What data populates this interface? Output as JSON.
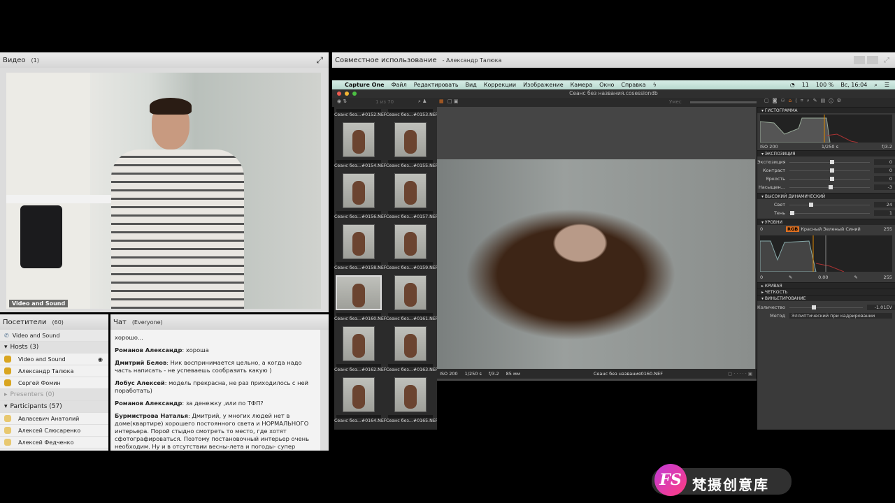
{
  "video_pod": {
    "title": "Видео",
    "count": "(1)",
    "feed_label": "Video and Sound"
  },
  "attendees": {
    "title": "Посетители",
    "count": "(60)",
    "audio_item": "Video and Sound",
    "groups": [
      {
        "label": "Hosts (3)",
        "expanded": true,
        "members": [
          "Video and Sound",
          "Александр Талюка",
          "Сергей Фомин"
        ]
      },
      {
        "label": "Presenters (0)",
        "expanded": false,
        "members": []
      },
      {
        "label": "Participants (57)",
        "expanded": true,
        "members": [
          "Авласевич Анатолий",
          "Алексей Слюсаренко",
          "Алексей Федченко"
        ]
      }
    ]
  },
  "chat": {
    "title": "Чат",
    "scope": "(Everyone)",
    "messages": [
      {
        "author": "",
        "text": "хорошо..."
      },
      {
        "author": "Романов Александр",
        "text": ": хороша"
      },
      {
        "author": "Дмитрий Белов",
        "text": ": Ник воспринимается цельно, а когда надо часть написать - не успеваешь сообразить какую )"
      },
      {
        "author": "Лобус Алексей",
        "text": ": модель прекрасна, не раз приходилось с ней поработать)"
      },
      {
        "author": "Романов Александр",
        "text": ": за денежку ,или по ТФП?"
      },
      {
        "author": "Бурмистрова Наталья",
        "text": ": Дмитрий, у многих людей нет в доме(квартире) хорошего постоянного света и НОРМАЛЬНОГО интерьера. Порой стыдно смотреть то место, где хотят сфотографироваться. Поэтому постановочный интерьер очень необходим.  Ну и в отсутствии весны-лета и погоды- супер вариант"
      }
    ]
  },
  "share_pod": {
    "title": "Совместное использование",
    "presenter": "- Александр Талюка"
  },
  "menubar": {
    "app": "Capture One",
    "items": [
      "Файл",
      "Редактировать",
      "Вид",
      "Коррекции",
      "Изображение",
      "Камера",
      "Окно",
      "Справка"
    ],
    "battery": "100 %",
    "clock": "Вс, 16:04",
    "badge": "11"
  },
  "window": {
    "title": "Сеанс без названия.cosessiondb",
    "count": "1 из 70",
    "zoom_label": "Умес"
  },
  "filmstrip": {
    "thumbs": [
      "Сеанс без...#0152.NEF",
      "Сеанс без...#0153.NEF",
      "Сеанс без...#0154.NEF",
      "Сеанс без...#0155.NEF",
      "Сеанс без...#0156.NEF",
      "Сеанс без...#0157.NEF",
      "Сеанс без...#0158.NEF",
      "Сеанс без...#0159.NEF",
      "Сеанс без...#0160.NEF",
      "Сеанс без...#0161.NEF",
      "Сеанс без...#0162.NEF",
      "Сеанс без...#0163.NEF",
      "Сеанс без...#0164.NEF",
      "Сеанс без...#0165.NEF"
    ],
    "selected": 8
  },
  "viewer": {
    "iso": "ISO 200",
    "shutter": "1/250 s",
    "aperture": "f/3.2",
    "focal": "85 мм",
    "filename": "Сеанс без названия0160.NEF"
  },
  "tools": {
    "histogram": {
      "title": "ГИСТОГРАММА",
      "iso": "ISO 200",
      "shutter": "1/250 s",
      "aperture": "f/3.2"
    },
    "exposure": {
      "title": "ЭКСПОЗИЦИЯ",
      "rows": [
        {
          "label": "Экспозиция",
          "value": "0",
          "pos": 0.5
        },
        {
          "label": "Контраст",
          "value": "0",
          "pos": 0.5
        },
        {
          "label": "Яркость",
          "value": "0",
          "pos": 0.5
        },
        {
          "label": "Насыщен...",
          "value": "-3",
          "pos": 0.49
        }
      ]
    },
    "hdr": {
      "title": "ВЫСОКИЙ ДИНАМИЧЕСКИЙ",
      "rows": [
        {
          "label": "Свет",
          "value": "24",
          "pos": 0.24
        },
        {
          "label": "Тень",
          "value": "1",
          "pos": 0.01
        }
      ]
    },
    "levels": {
      "title": "УРОВНИ",
      "low": "0",
      "high": "255",
      "channels": [
        "RGB",
        "Красный",
        "Зеленый",
        "Синий"
      ],
      "out_low": "0",
      "mid": "0.00",
      "out_high": "255"
    },
    "curve": "КРИВАЯ",
    "clarity": "ЧЕТКОСТЬ",
    "vignette": {
      "title": "ВИНЬЕТИРОВАНИЕ",
      "amount_label": "Количество",
      "amount": "-1.01EV",
      "method_label": "Метод",
      "method": "Эллиптический при кадрировании"
    }
  },
  "watermark": {
    "text": "梵摄创意库",
    "logo": "FS"
  }
}
